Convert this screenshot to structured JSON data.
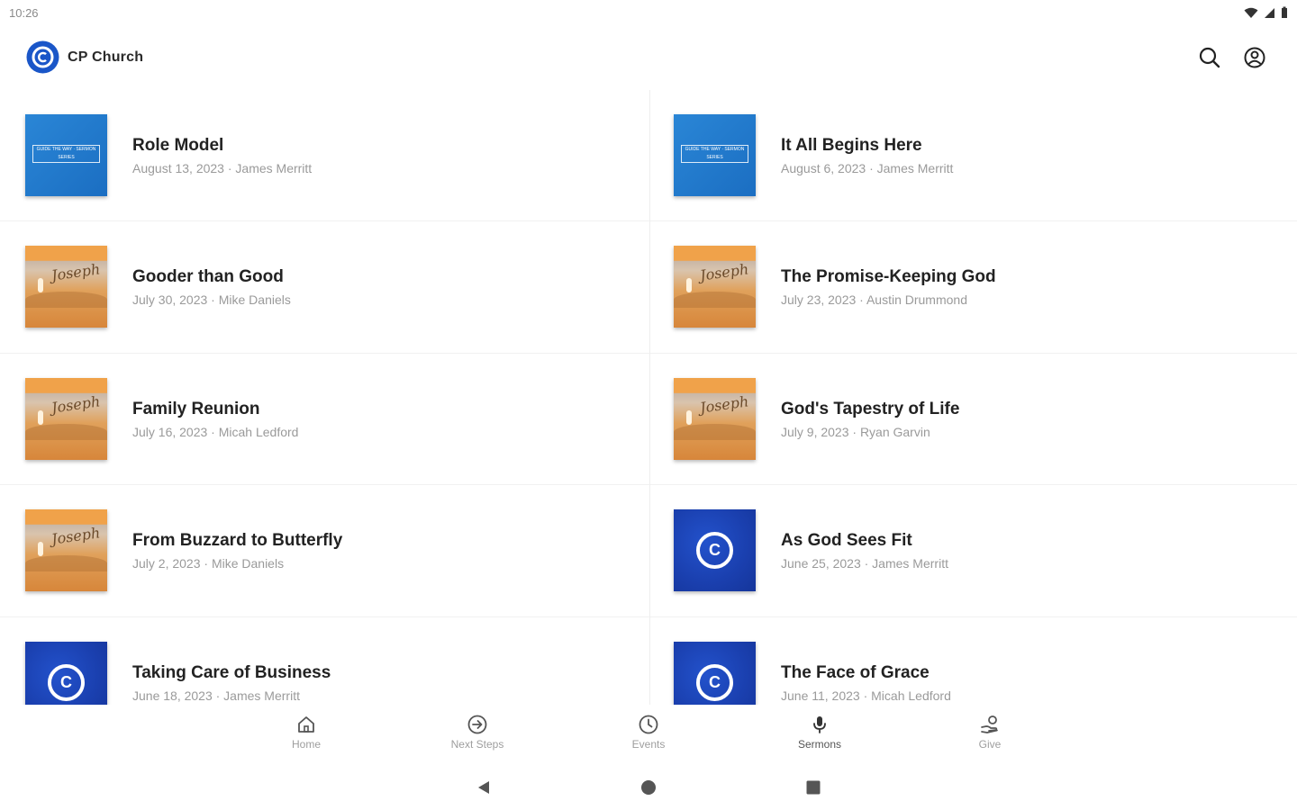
{
  "status": {
    "time": "10:26",
    "icons": [
      "wifi-icon",
      "signal-icon",
      "battery-icon"
    ]
  },
  "app": {
    "title": "CP Church",
    "logo_letter": "C",
    "accent": "#1a56c8"
  },
  "sermons": [
    {
      "title": "Role Model",
      "subtitle": "August 13, 2023 · James Merritt",
      "thumb": "blue",
      "thumb_text": "GUIDE THE WAY · SERMON SERIES"
    },
    {
      "title": "It All Begins Here",
      "subtitle": "August 6, 2023 · James Merritt",
      "thumb": "blue",
      "thumb_text": "GUIDE THE WAY · SERMON SERIES"
    },
    {
      "title": "Gooder than Good",
      "subtitle": "July 30, 2023 · Mike Daniels",
      "thumb": "sand",
      "thumb_text": "Joseph"
    },
    {
      "title": "The Promise-Keeping God",
      "subtitle": "July 23, 2023 · Austin Drummond",
      "thumb": "sand",
      "thumb_text": "Joseph"
    },
    {
      "title": "Family Reunion",
      "subtitle": "July 16, 2023 · Micah Ledford",
      "thumb": "sand",
      "thumb_text": "Joseph"
    },
    {
      "title": "God's Tapestry of Life",
      "subtitle": "July 9, 2023 · Ryan Garvin",
      "thumb": "sand",
      "thumb_text": "Joseph"
    },
    {
      "title": "From Buzzard to Butterfly",
      "subtitle": "July 2, 2023 · Mike Daniels",
      "thumb": "sand",
      "thumb_text": "Joseph"
    },
    {
      "title": "As God Sees Fit",
      "subtitle": "June 25, 2023 · James Merritt",
      "thumb": "logo",
      "thumb_text": "C"
    },
    {
      "title": "Taking Care of Business",
      "subtitle": "June 18, 2023 · James Merritt",
      "thumb": "logo",
      "thumb_text": "C"
    },
    {
      "title": "The Face of Grace",
      "subtitle": "June 11, 2023 · Micah Ledford",
      "thumb": "logo",
      "thumb_text": "C"
    }
  ],
  "bottom_nav": [
    {
      "label": "Home",
      "icon": "home-icon"
    },
    {
      "label": "Next Steps",
      "icon": "arrow-circle-icon"
    },
    {
      "label": "Events",
      "icon": "clock-icon"
    },
    {
      "label": "Sermons",
      "icon": "microphone-icon"
    },
    {
      "label": "Give",
      "icon": "give-hand-icon"
    }
  ],
  "system_nav": [
    {
      "icon": "back-triangle-icon"
    },
    {
      "icon": "home-circle-icon"
    },
    {
      "icon": "recents-square-icon"
    }
  ]
}
